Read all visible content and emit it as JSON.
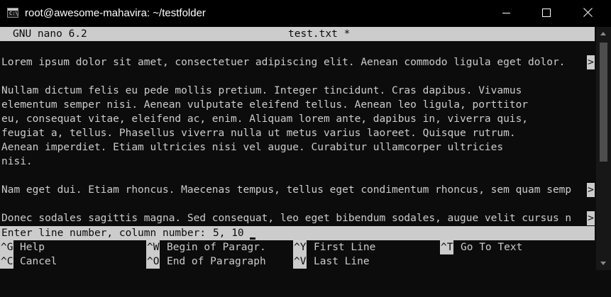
{
  "window": {
    "title": "root@awesome-mahavira: ~/testfolder",
    "icon": "terminal-icon",
    "controls": [
      "minimize-icon",
      "maximize-icon",
      "close-icon"
    ]
  },
  "nano": {
    "version": "GNU nano 6.2",
    "filename": "test.txt *"
  },
  "editor": {
    "lines": [
      "",
      "Lorem ipsum dolor sit amet, consectetuer adipiscing elit. Aenean commodo ligula eget dolor.",
      "",
      "Nullam dictum felis eu pede mollis pretium. Integer tincidunt. Cras dapibus. Vivamus",
      "elementum semper nisi. Aenean vulputate eleifend tellus. Aenean leo ligula, porttitor",
      "eu, consequat vitae, eleifend ac, enim. Aliquam lorem ante, dapibus in, viverra quis,",
      "feugiat a, tellus. Phasellus viverra nulla ut metus varius laoreet. Quisque rutrum.",
      "Aenean imperdiet. Etiam ultricies nisi vel augue. Curabitur ullamcorper ultricies",
      "nisi.",
      "",
      "Nam eget dui. Etiam rhoncus. Maecenas tempus, tellus eget condimentum rhoncus, sem quam semp",
      "",
      "Donec sodales sagittis magna. Sed consequat, leo eget bibendum sodales, augue velit cursus n"
    ],
    "overflow_marker": ">"
  },
  "prompt": {
    "label": "Enter line number, column number:",
    "value": "5, 10"
  },
  "shortcuts": [
    {
      "key": "^G",
      "label": "Help"
    },
    {
      "key": "^W",
      "label": "Begin of Paragr."
    },
    {
      "key": "^Y",
      "label": "First Line"
    },
    {
      "key": "^T",
      "label": "Go To Text"
    },
    {
      "key": "^C",
      "label": "Cancel"
    },
    {
      "key": "^O",
      "label": "End of Paragraph"
    },
    {
      "key": "^V",
      "label": "Last Line"
    }
  ],
  "colors": {
    "background": "#0c0c0c",
    "foreground": "#cccccc",
    "titlebar": "#000000"
  }
}
